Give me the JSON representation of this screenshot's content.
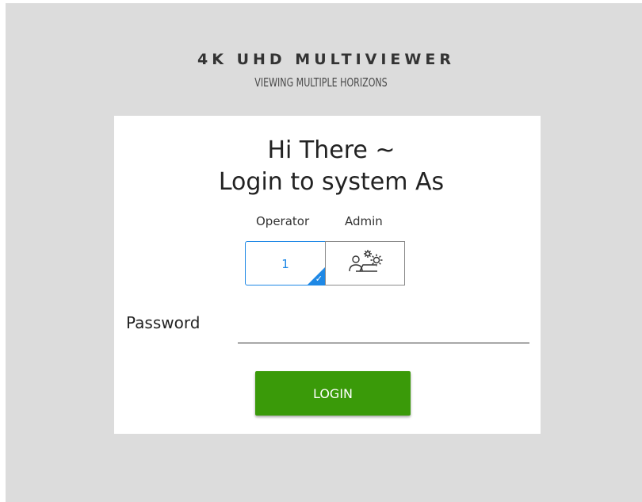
{
  "brand": {
    "title": "4K UHD MULTIVIEWER",
    "tagline": "VIEWING MULTIPLE HORIZONS"
  },
  "login": {
    "greeting_line1": "Hi There ~",
    "greeting_line2": "Login to system As",
    "roles": [
      {
        "label": "Operator",
        "value": "1",
        "selected": true
      },
      {
        "label": "Admin",
        "icon": "admin-settings-icon",
        "selected": false
      }
    ],
    "password_label": "Password",
    "password_value": "",
    "submit_label": "LOGIN"
  },
  "colors": {
    "background": "#dcdcdc",
    "card": "#ffffff",
    "accent_blue": "#1e88e5",
    "login_green": "#3a9a09"
  }
}
